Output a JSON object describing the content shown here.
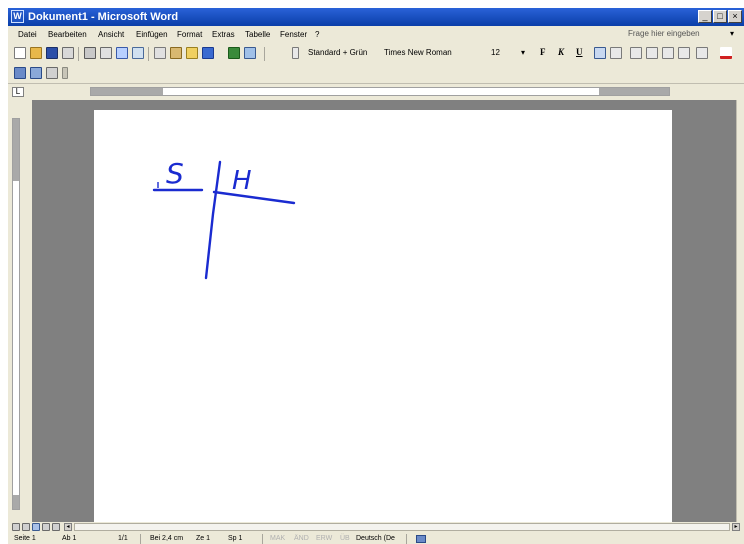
{
  "app": {
    "title": "Dokument1 - Microsoft Word",
    "window_buttons": {
      "minimize": "_",
      "maximize": "□",
      "close": "×"
    }
  },
  "menu": {
    "items": [
      "Datei",
      "Bearbeiten",
      "Ansicht",
      "Einfügen",
      "Format",
      "Extras",
      "Tabelle",
      "Fenster",
      "?"
    ],
    "help_placeholder": "Frage hier eingeben",
    "help_arrow": "▾"
  },
  "formatting": {
    "style": "Standard + Grün",
    "font": "Times New Roman",
    "size": "12",
    "bold": "F",
    "italic": "K",
    "underline": "U"
  },
  "document": {
    "handwriting": {
      "letters": [
        "S",
        "H"
      ],
      "ink_color": "#1a2bd0"
    }
  },
  "status": {
    "page": "Seite 1",
    "section": "Ab 1",
    "pages": "1/1",
    "position": "Bei 2,4 cm",
    "line": "Ze 1",
    "column": "Sp 1",
    "mak": "MAK",
    "and": "ÄND",
    "erw": "ERW",
    "ub": "ÜB",
    "language": "Deutsch (De"
  },
  "colors": {
    "titlebar": "#0a3ea8",
    "chrome": "#ece9d8",
    "workspace": "#808080",
    "ink": "#1a2bd0"
  }
}
